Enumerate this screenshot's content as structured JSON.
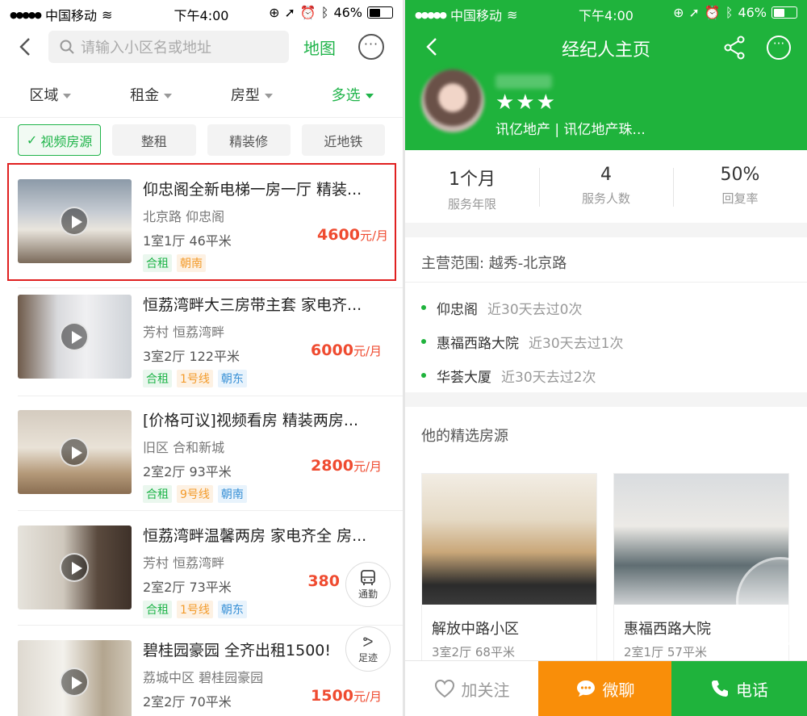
{
  "left": {
    "status": {
      "carrier": "中国移动",
      "time": "下午4:00",
      "battery": "46%"
    },
    "search": {
      "placeholder": "请输入小区名或地址"
    },
    "map_label": "地图",
    "filters": [
      "区域",
      "租金",
      "房型",
      "多选"
    ],
    "tags": [
      "视频房源",
      "整租",
      "精装修",
      "近地铁"
    ],
    "listings": [
      {
        "title": "仰忠阁全新电梯一房一厅 精装...",
        "location": "北京路 仰忠阁",
        "spec": "1室1厅 46平米",
        "price": "4600",
        "unit": "元/月",
        "labels": [
          {
            "text": "合租",
            "color": "green"
          },
          {
            "text": "朝南",
            "color": "orange"
          }
        ]
      },
      {
        "title": "恒荔湾畔大三房带主套 家电齐...",
        "location": "芳村 恒荔湾畔",
        "spec": "3室2厅 122平米",
        "price": "6000",
        "unit": "元/月",
        "labels": [
          {
            "text": "合租",
            "color": "green"
          },
          {
            "text": "1号线",
            "color": "orange"
          },
          {
            "text": "朝东",
            "color": "blue"
          }
        ]
      },
      {
        "title": "[价格可议]视频看房 精装两房...",
        "location": "旧区 合和新城",
        "spec": "2室2厅 93平米",
        "price": "2800",
        "unit": "元/月",
        "labels": [
          {
            "text": "合租",
            "color": "green"
          },
          {
            "text": "9号线",
            "color": "orange"
          },
          {
            "text": "朝南",
            "color": "blue"
          }
        ]
      },
      {
        "title": "恒荔湾畔温馨两房 家电齐全 房...",
        "location": "芳村 恒荔湾畔",
        "spec": "2室2厅 73平米",
        "price": "380",
        "unit": "",
        "labels": [
          {
            "text": "合租",
            "color": "green"
          },
          {
            "text": "1号线",
            "color": "orange"
          },
          {
            "text": "朝东",
            "color": "blue"
          }
        ]
      },
      {
        "title": "碧桂园豪园 全齐出租1500!",
        "location": "荔城中区 碧桂园豪园",
        "spec": "2室2厅 70平米",
        "price": "1500",
        "unit": "元/月",
        "labels": []
      }
    ],
    "fab_commute": "通勤",
    "fab_footprint": "足迹"
  },
  "right": {
    "status": {
      "carrier": "中国移动",
      "time": "下午4:00",
      "battery": "46%"
    },
    "title": "经纪人主页",
    "company": "讯亿地产 | 讯亿地产珠...",
    "stats": [
      {
        "value": "1个月",
        "label": "服务年限"
      },
      {
        "value": "4",
        "label": "服务人数"
      },
      {
        "value": "50%",
        "label": "回复率"
      }
    ],
    "scope": "主营范围: 越秀-北京路",
    "visits": [
      {
        "name": "仰忠阁",
        "stat": "近30天去过0次"
      },
      {
        "name": "惠福西路大院",
        "stat": "近30天去过1次"
      },
      {
        "name": "华荟大厦",
        "stat": "近30天去过2次"
      }
    ],
    "selected_title": "他的精选房源",
    "cards": [
      {
        "name": "解放中路小区",
        "spec": "3室2厅 68平米"
      },
      {
        "name": "惠福西路大院",
        "spec": "2室1厅 57平米"
      }
    ],
    "bottom": {
      "follow": "加关注",
      "chat": "微聊",
      "phone": "电话"
    }
  },
  "colors": {
    "green": "#1fb33c",
    "price": "#ef4b30",
    "orange": "#f98e09",
    "highlight": "#e02020"
  }
}
